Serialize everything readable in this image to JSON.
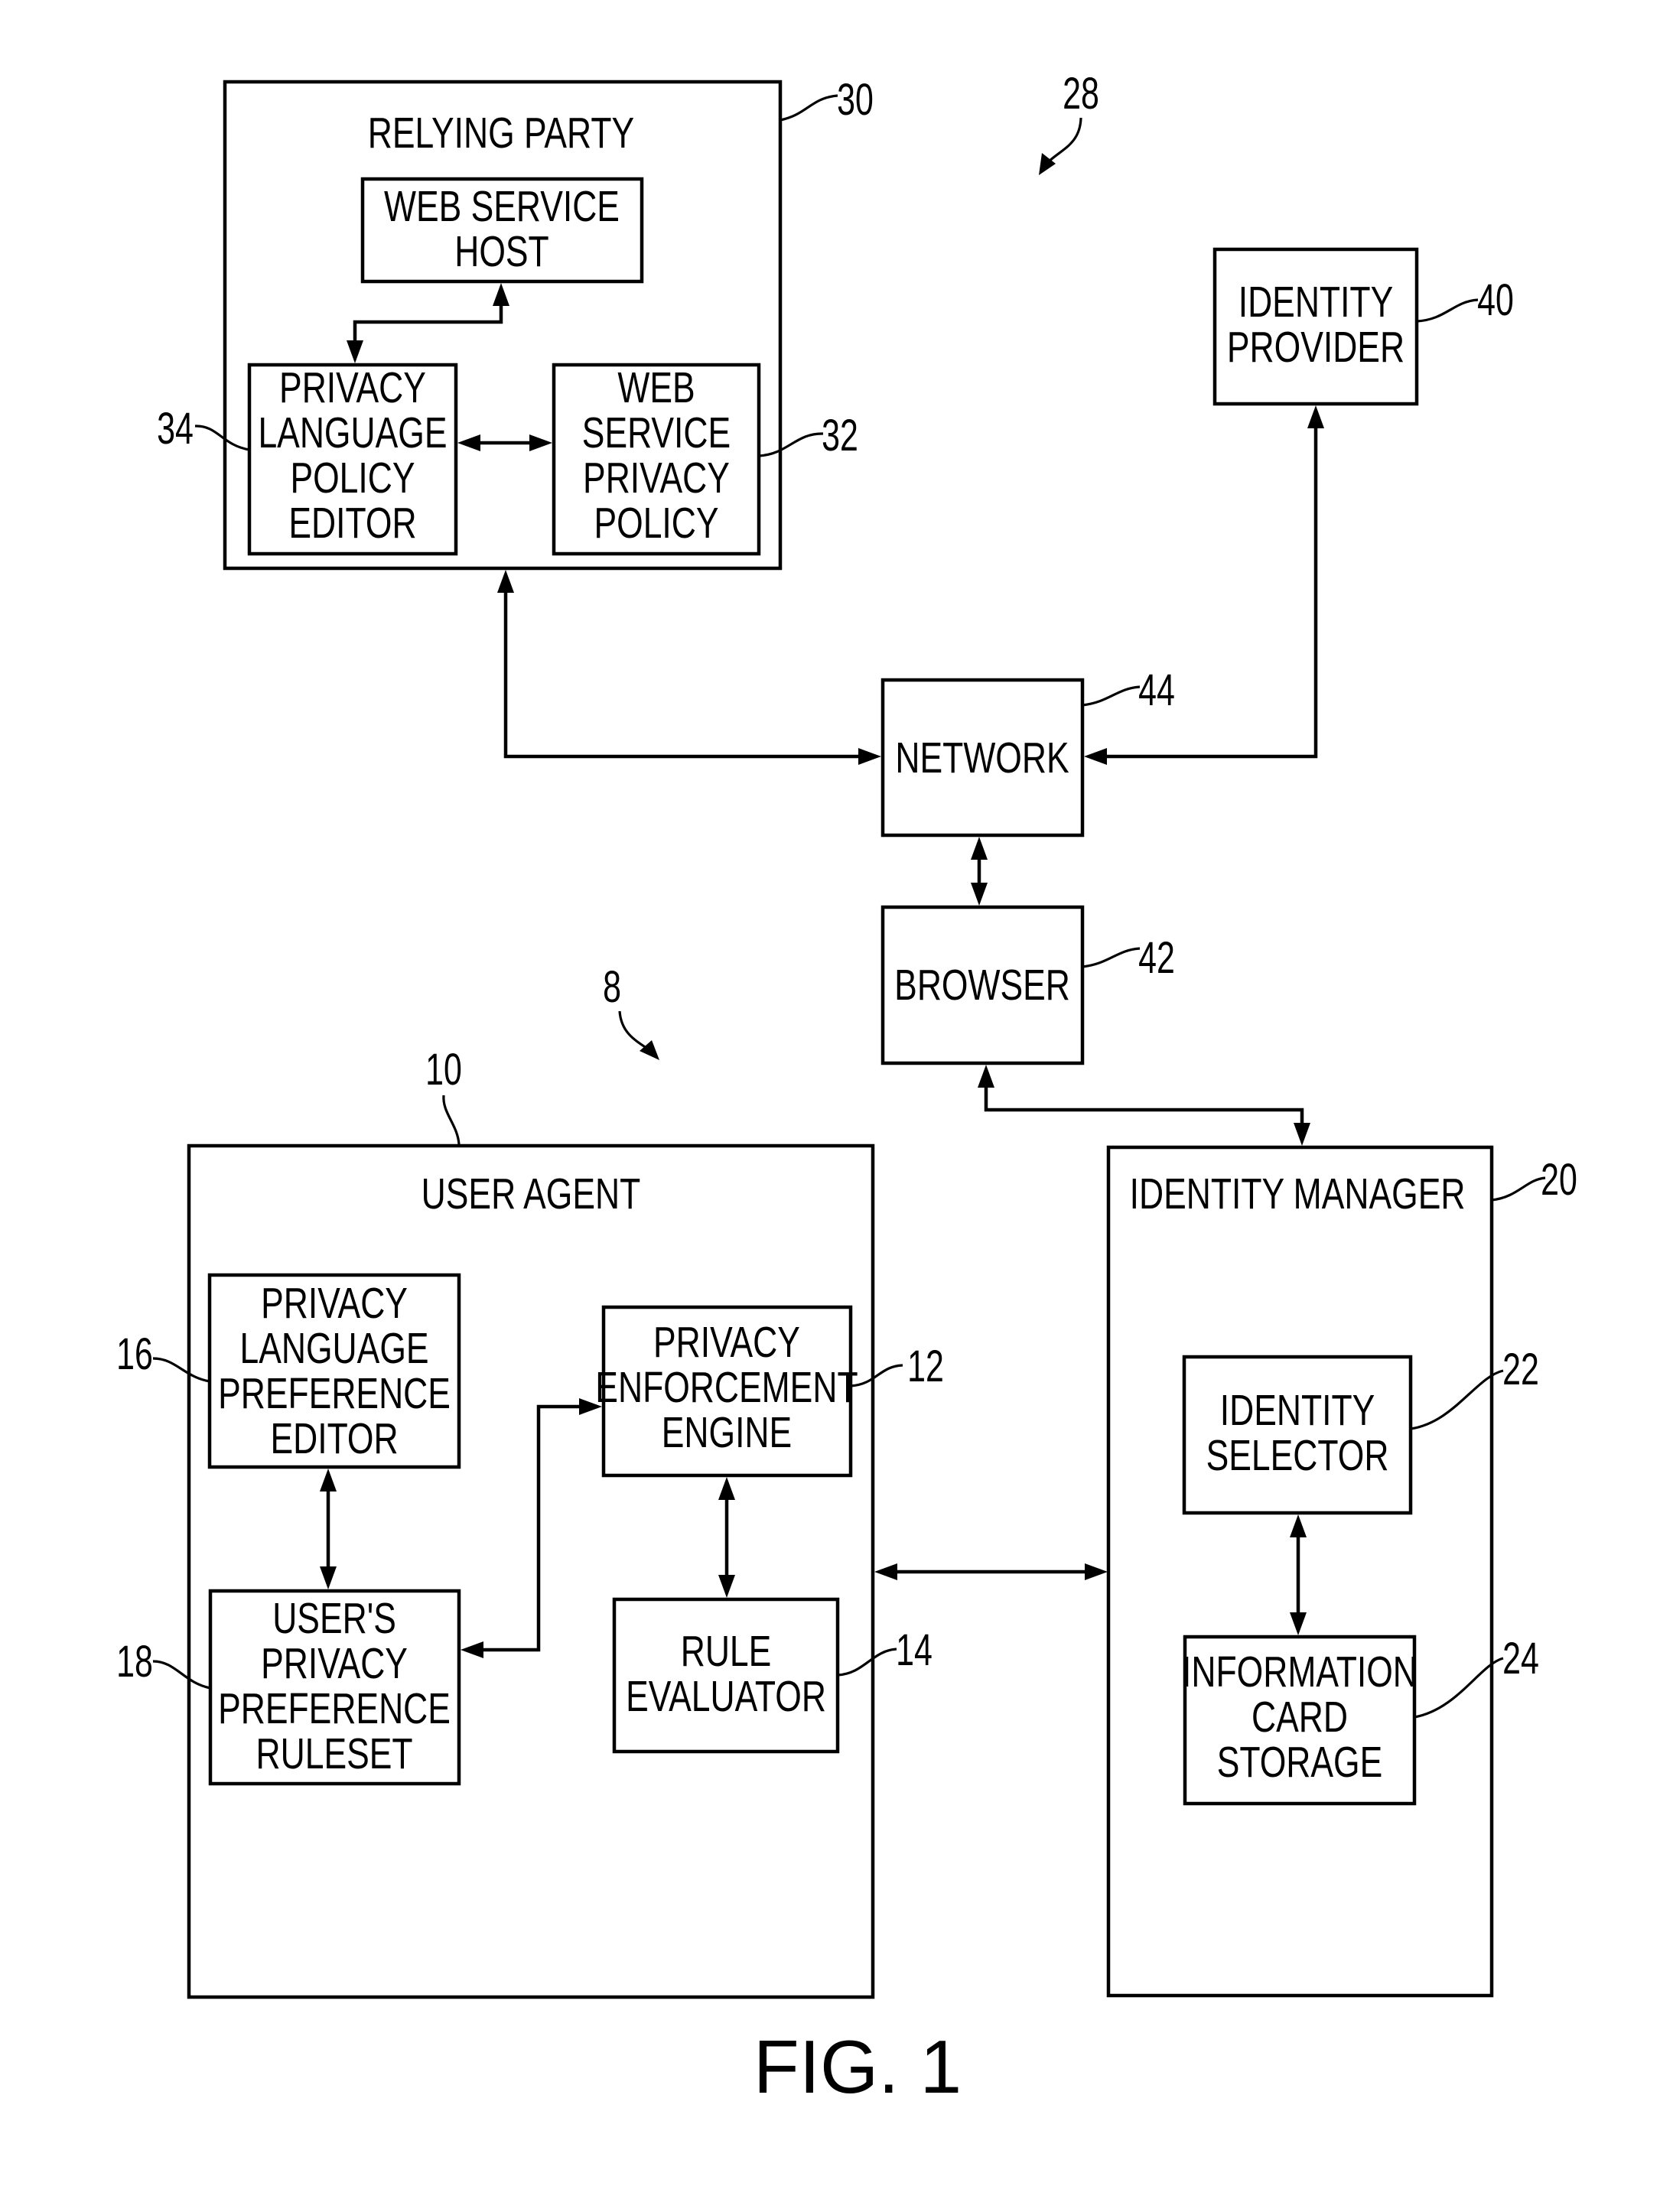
{
  "figure": {
    "caption": "FIG. 1",
    "system_refs": {
      "relying_side": "28",
      "user_side": "8"
    }
  },
  "components": {
    "relying_party": {
      "title": "RELYING PARTY",
      "ref": "30"
    },
    "web_service_host": {
      "lines": [
        "WEB SERVICE",
        "HOST"
      ]
    },
    "privacy_language_policy_editor": {
      "lines": [
        "PRIVACY",
        "LANGUAGE",
        "POLICY",
        "EDITOR"
      ],
      "ref": "34"
    },
    "web_service_privacy_policy": {
      "lines": [
        "WEB",
        "SERVICE",
        "PRIVACY",
        "POLICY"
      ],
      "ref": "32"
    },
    "identity_provider": {
      "lines": [
        "IDENTITY",
        "PROVIDER"
      ],
      "ref": "40"
    },
    "network": {
      "lines": [
        "NETWORK"
      ],
      "ref": "44"
    },
    "browser": {
      "lines": [
        "BROWSER"
      ],
      "ref": "42"
    },
    "user_agent": {
      "title": "USER AGENT",
      "ref": "10"
    },
    "privacy_language_preference_editor": {
      "lines": [
        "PRIVACY",
        "LANGUAGE",
        "PREFERENCE",
        "EDITOR"
      ],
      "ref": "16"
    },
    "users_privacy_preference_ruleset": {
      "lines": [
        "USER'S",
        "PRIVACY",
        "PREFERENCE",
        "RULESET"
      ],
      "ref": "18"
    },
    "privacy_enforcement_engine": {
      "lines": [
        "PRIVACY",
        "ENFORCEMENT",
        "ENGINE"
      ],
      "ref": "12"
    },
    "rule_evaluator": {
      "lines": [
        "RULE",
        "EVALUATOR"
      ],
      "ref": "14"
    },
    "identity_manager": {
      "title": "IDENTITY MANAGER",
      "ref": "20"
    },
    "identity_selector": {
      "lines": [
        "IDENTITY",
        "SELECTOR"
      ],
      "ref": "22"
    },
    "information_card_storage": {
      "lines": [
        "INFORMATION",
        "CARD",
        "STORAGE"
      ],
      "ref": "24"
    }
  },
  "connections": [
    {
      "from": "web_service_host",
      "to": "privacy_language_policy_editor",
      "direction": "bidirectional"
    },
    {
      "from": "privacy_language_policy_editor",
      "to": "web_service_privacy_policy",
      "direction": "bidirectional"
    },
    {
      "from": "relying_party",
      "to": "network",
      "direction": "bidirectional"
    },
    {
      "from": "identity_provider",
      "to": "network",
      "direction": "bidirectional"
    },
    {
      "from": "network",
      "to": "browser",
      "direction": "bidirectional"
    },
    {
      "from": "browser",
      "to": "identity_manager",
      "direction": "bidirectional"
    },
    {
      "from": "privacy_language_preference_editor",
      "to": "users_privacy_preference_ruleset",
      "direction": "bidirectional"
    },
    {
      "from": "users_privacy_preference_ruleset",
      "to": "privacy_enforcement_engine",
      "direction": "bidirectional"
    },
    {
      "from": "privacy_enforcement_engine",
      "to": "rule_evaluator",
      "direction": "bidirectional"
    },
    {
      "from": "user_agent",
      "to": "identity_manager",
      "direction": "bidirectional"
    },
    {
      "from": "identity_selector",
      "to": "information_card_storage",
      "direction": "bidirectional"
    }
  ]
}
